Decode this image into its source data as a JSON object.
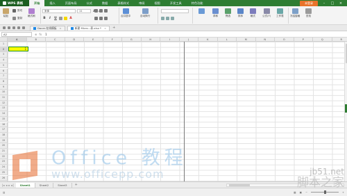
{
  "app": {
    "name": "WPS 表格"
  },
  "ribbon_tabs": [
    "开始",
    "插入",
    "页面布局",
    "公式",
    "数据",
    "表格样式",
    "审阅",
    "视图",
    "开发工具",
    "特色功能"
  ],
  "title_right": {
    "login": "未登录"
  },
  "ribbon": {
    "paste": "粘贴",
    "cut": "剪切",
    "copy": "复制",
    "format_painter": "格式刷",
    "font_name": "宋体",
    "font_size": "11",
    "merge_center": "合并居中",
    "wrap": "自动换行",
    "sum": "求和",
    "filter": "筛选",
    "sort": "排序",
    "format": "格式",
    "formula": "公式(F)",
    "worksheet": "工作表",
    "freeze": "冻结窗格",
    "find": "查找"
  },
  "doc_tabs": [
    {
      "label": "Docer-在线模板",
      "active": false
    },
    {
      "label": "新建 Micro...表.xlsx *",
      "active": true
    }
  ],
  "formula_bar": {
    "cell_ref": "A2",
    "value": "1"
  },
  "columns": [
    "A",
    "B",
    "C",
    "D",
    "E",
    "F",
    "G",
    "H",
    "I",
    "J",
    "K",
    "L",
    "M",
    "N",
    "O",
    "P",
    "Q",
    "R"
  ],
  "rows": [
    "1",
    "2",
    "3",
    "4",
    "5",
    "6",
    "7",
    "8",
    "9",
    "10",
    "11",
    "12",
    "13",
    "14",
    "15",
    "16",
    "17",
    "18",
    "19",
    "20",
    "21",
    "22",
    "23",
    "24",
    "25",
    "26",
    "27"
  ],
  "selected": {
    "column": "A",
    "row": "2",
    "value": "1"
  },
  "sheets": [
    {
      "label": "Sheet1",
      "active": true
    },
    {
      "label": "Sheet2",
      "active": false
    },
    {
      "label": "Sheet3",
      "active": false
    }
  ],
  "watermark": {
    "title": "Office 教程",
    "url": "www.officepp.com"
  },
  "site_watermark": {
    "url": "jb51.net",
    "name": "脚本之家"
  },
  "colors": {
    "accent": "#2e7d32",
    "selection_fill": "#ffff00",
    "login": "#e8732a"
  }
}
